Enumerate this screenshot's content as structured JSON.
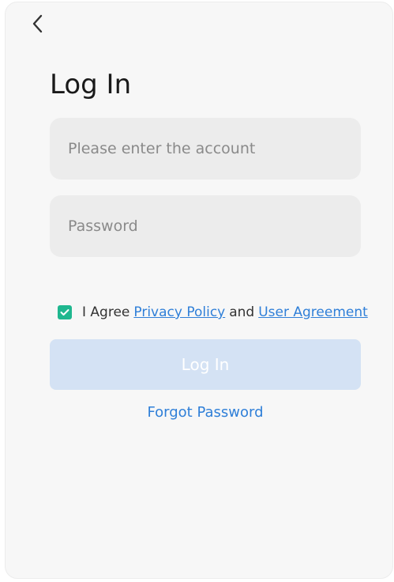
{
  "header": {
    "back_icon": "chevron-left-icon",
    "title": "Log In"
  },
  "form": {
    "account_placeholder": "Please enter the account",
    "password_placeholder": "Password",
    "agreement": {
      "checked": true,
      "prefix": "I Agree",
      "privacy_link": "Privacy Policy",
      "conjunction": "and",
      "user_agreement_link": "User Agreement"
    },
    "login_label": "Log In",
    "forgot_label": "Forgot Password"
  },
  "colors": {
    "accent": "#2f7fd8",
    "checkbox": "#1fb78f",
    "login_button_disabled": "#d4e2f4",
    "field_background": "#ececec",
    "page_background": "#f7f7f7"
  }
}
